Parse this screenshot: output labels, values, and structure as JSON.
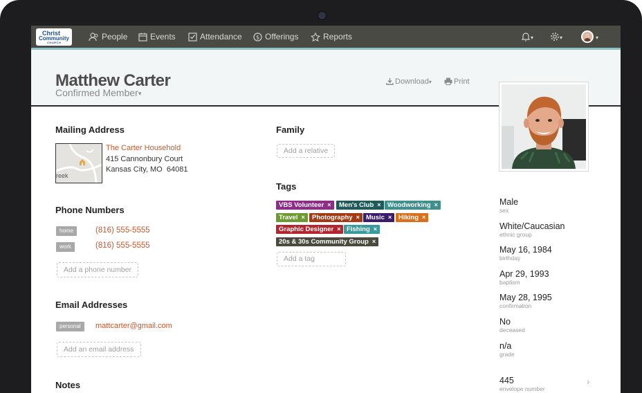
{
  "nav": {
    "logo": {
      "line1": "Christ",
      "line2": "Community",
      "line3": "CHURCH"
    },
    "items": [
      {
        "label": "People",
        "icon": "people-icon"
      },
      {
        "label": "Events",
        "icon": "calendar-icon"
      },
      {
        "label": "Attendance",
        "icon": "checkbox-icon"
      },
      {
        "label": "Offerings",
        "icon": "dollar-icon"
      },
      {
        "label": "Reports",
        "icon": "star-icon"
      }
    ],
    "caret": "▾"
  },
  "profile": {
    "name": "Matthew Carter",
    "status": "Confirmed Member",
    "status_caret": "▾",
    "download_label": "Download",
    "download_caret": "▾",
    "print_label": "Print"
  },
  "mailing": {
    "title": "Mailing Address",
    "household": "The Carter Household",
    "street": "415 Cannonbury Court",
    "city": "Kansas City, MO",
    "zip": "64081",
    "map_label": "reek"
  },
  "phones": {
    "title": "Phone Numbers",
    "items": [
      {
        "type": "home",
        "number": "(816) 555-5555"
      },
      {
        "type": "work",
        "number": "(816) 555-5555"
      }
    ],
    "add_label": "Add a phone number"
  },
  "emails": {
    "title": "Email Addresses",
    "items": [
      {
        "type": "personal",
        "address": "mattcarter@gmail.com"
      }
    ],
    "add_label": "Add an email address"
  },
  "notes": {
    "title": "Notes"
  },
  "family": {
    "title": "Family",
    "add_label": "Add a relative"
  },
  "tags": {
    "title": "Tags",
    "remove_glyph": "×",
    "items": [
      {
        "label": "VBS Volunteer",
        "color": "#8e2c8a"
      },
      {
        "label": "Men's Club",
        "color": "#1f5a5a"
      },
      {
        "label": "Woodworking",
        "color": "#3f8f8c"
      },
      {
        "label": "Travel",
        "color": "#6d9a32"
      },
      {
        "label": "Photography",
        "color": "#a23a14"
      },
      {
        "label": "Music",
        "color": "#3a1d6b"
      },
      {
        "label": "Hiking",
        "color": "#d9701c"
      },
      {
        "label": "Graphic Designer",
        "color": "#b4262d"
      },
      {
        "label": "Fishing",
        "color": "#3a9b9c"
      },
      {
        "label": "20s & 30s Community Group",
        "color": "#4a4a3f"
      }
    ],
    "add_label": "Add a tag"
  },
  "facts": [
    {
      "value": "Male",
      "label": "sex"
    },
    {
      "value": "White/Caucasian",
      "label": "ethnic group"
    },
    {
      "value": "May 16, 1984",
      "label": "birthday"
    },
    {
      "value": "Apr 29, 1993",
      "label": "baptism"
    },
    {
      "value": "May 28, 1995",
      "label": "confirmation"
    },
    {
      "value": "No",
      "label": "deceased"
    },
    {
      "value": "n/a",
      "label": "grade"
    },
    {
      "value": "445",
      "label": "envelope number"
    }
  ],
  "colors": {
    "accent": "#c4572a",
    "nav_bg": "#4a4a45",
    "nav_border": "#8fc4c6"
  }
}
